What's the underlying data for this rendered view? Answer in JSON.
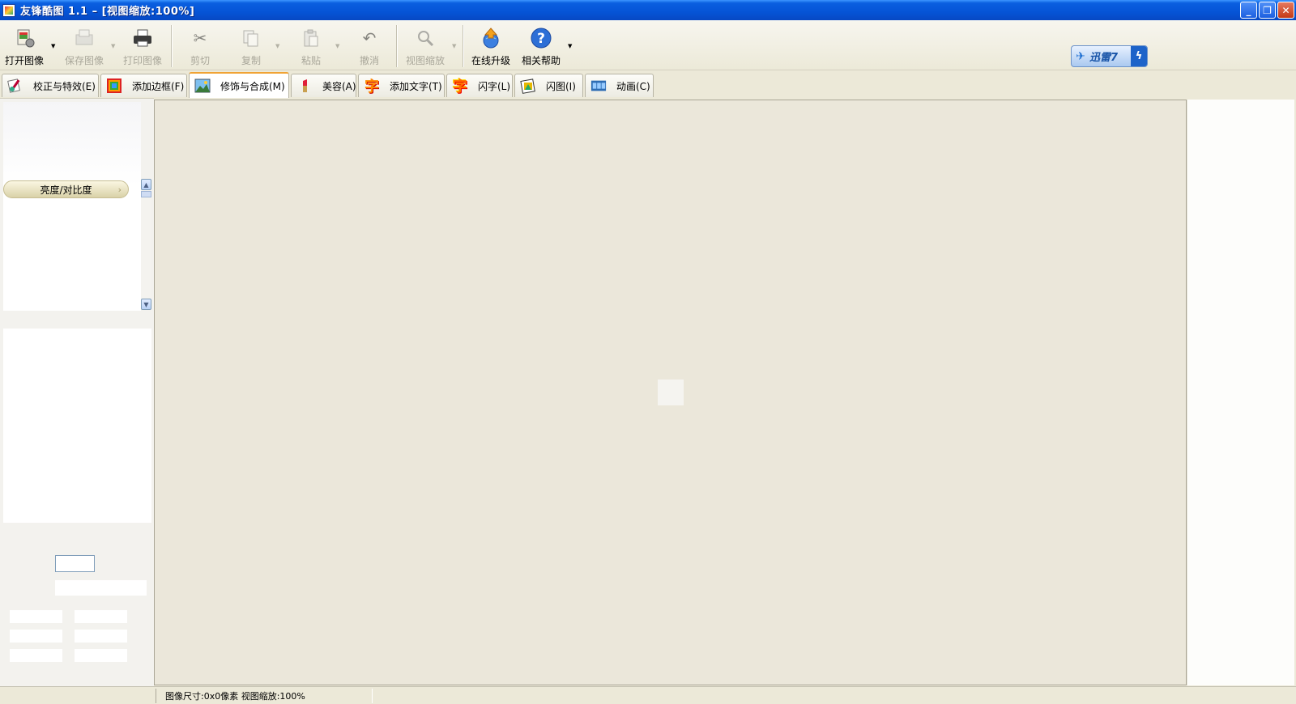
{
  "window": {
    "title": "友锋酷图 1.1 – [视图缩放:100%]",
    "minimize": "_",
    "restore": "❐",
    "close": "✕"
  },
  "toolbar": {
    "open": "打开图像",
    "save": "保存图像",
    "print": "打印图像",
    "cut": "剪切",
    "copy": "复制",
    "paste": "粘贴",
    "undo": "撤消",
    "zoom": "视图缩放",
    "upgrade": "在线升级",
    "help": "相关帮助"
  },
  "xunlei": {
    "label": "迅雷7",
    "bolt": "ϟ"
  },
  "tabs": [
    {
      "label": "校正与特效(E)",
      "icon": "brush-icon"
    },
    {
      "label": "添加边框(F)",
      "icon": "frame-icon"
    },
    {
      "label": "修饰与合成(M)",
      "icon": "landscape-icon"
    },
    {
      "label": "美容(A)",
      "icon": "lipstick-icon"
    },
    {
      "label": "添加文字(T)",
      "icon": "text-icon"
    },
    {
      "label": "闪字(L)",
      "icon": "flash-text-icon"
    },
    {
      "label": "闪图(I)",
      "icon": "flash-image-icon"
    },
    {
      "label": "动画(C)",
      "icon": "film-icon"
    }
  ],
  "left_panel": {
    "item": "亮度/对比度"
  },
  "status": {
    "text": "图像尺寸:0x0像素 视图缩放:100%"
  },
  "colors": {
    "titlebar": "#0554d6",
    "tab_active_accent": "#f0a334",
    "background": "#ece9d8"
  }
}
